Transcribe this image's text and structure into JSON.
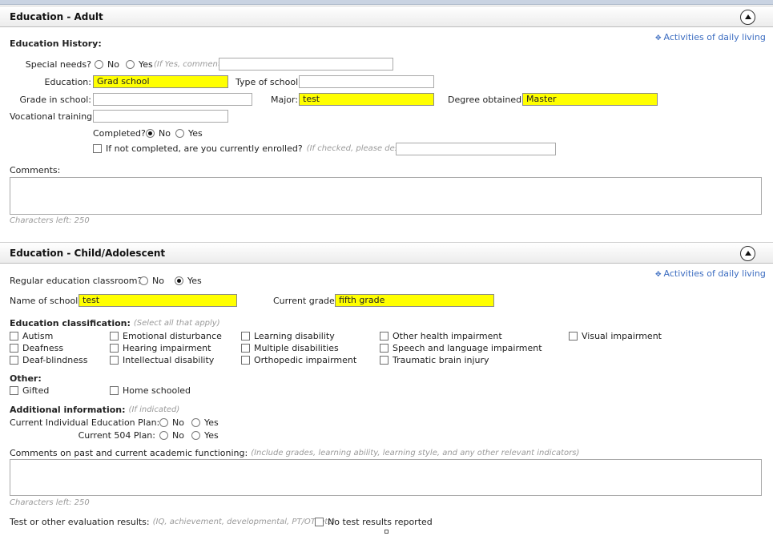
{
  "adult": {
    "title": "Education - Adult",
    "activities_link": "Activities of daily living",
    "history_label": "Education History:",
    "special_needs_label": "Special needs?",
    "no": "No",
    "yes": "Yes",
    "special_needs_hint": "(If Yes, comment)",
    "education_label": "Education:",
    "education_value": "Grad school",
    "type_of_school_label": "Type of school:",
    "type_of_school_value": "",
    "grade_label": "Grade in school:",
    "grade_value": "",
    "major_label": "Major:",
    "major_value": "test",
    "degree_label": "Degree obtained:",
    "degree_value": "Master",
    "vocational_label": "Vocational training:",
    "vocational_value": "",
    "completed_label": "Completed?",
    "completed_selected": "No",
    "enrolled_label": "If not completed, are you currently enrolled?",
    "enrolled_hint": "(If checked, please describe)",
    "comments_label": "Comments:",
    "chars_left": "Characters left:  250"
  },
  "child": {
    "title": "Education - Child/Adolescent",
    "activities_link": "Activities of daily living",
    "regular_label": "Regular education classroom?",
    "regular_selected": "Yes",
    "no": "No",
    "yes": "Yes",
    "school_name_label": "Name of school:",
    "school_name_value": "test",
    "current_grade_label": "Current grade:",
    "current_grade_value": "fifth grade",
    "classification_label": "Education classification:",
    "classification_hint": "(Select all that apply)",
    "classification_items": [
      "Autism",
      "Deafness",
      "Deaf-blindness",
      "Emotional disturbance",
      "Hearing impairment",
      "Intellectual disability",
      "Learning disability",
      "Multiple disabilities",
      "Orthopedic impairment",
      "Other health impairment",
      "Speech and language impairment",
      "Traumatic brain injury",
      "Visual impairment"
    ],
    "other_label": "Other:",
    "other_items": [
      "Gifted",
      "Home schooled"
    ],
    "additional_label": "Additional information:",
    "additional_hint": "(If indicated)",
    "iep_label": "Current Individual Education Plan:",
    "plan504_label": "Current 504 Plan:",
    "comments_label": "Comments on past and current academic functioning:",
    "comments_hint": "(Include grades, learning ability, learning style, and any other relevant indicators)",
    "chars_left": "Characters left:  250",
    "test_label": "Test or other evaluation results:",
    "test_hint": "(IQ, achievement, developmental, PT/OT, etc)",
    "no_test_label": "No test results reported"
  }
}
